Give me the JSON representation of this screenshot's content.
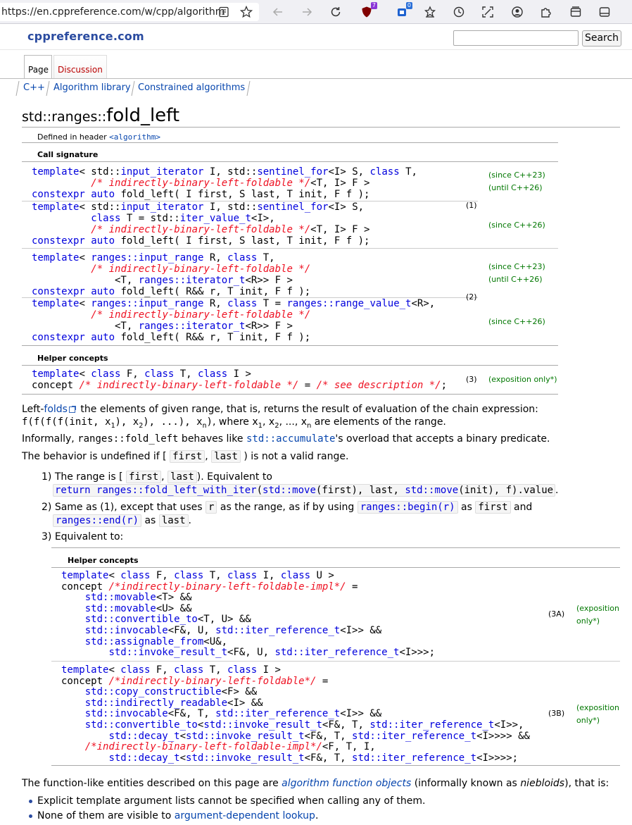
{
  "browser": {
    "url": "https://en.cppreference.com/w/cpp/algorithm",
    "badge_shield": "7",
    "badge_ext": "0"
  },
  "site": {
    "logo": "cppreference.com",
    "search_button": "Search",
    "tabs": [
      "Page",
      "Discussion"
    ],
    "breadcrumbs": [
      "C++",
      "Algorithm library",
      "Constrained algorithms"
    ]
  },
  "title": {
    "ns": "std::ranges::",
    "name": "fold_left"
  },
  "header_decl": {
    "prefix": "Defined in header ",
    "header": "<algorithm>"
  },
  "sections": {
    "call_signature": "Call signature",
    "helper_concepts": "Helper concepts"
  },
  "versions": {
    "since23": "(since C++23)",
    "until26": "(until C++26)",
    "since26": "(since C++26)",
    "expo": "(exposition only*)",
    "expo1": "(exposition",
    "expo2": "only*)"
  },
  "tags": {
    "t1": "(1)",
    "t2": "(2)",
    "t3": "(3)",
    "t3a": "(3A)",
    "t3b": "(3B)"
  },
  "desc": {
    "p1_a": "Left-",
    "p1_link": "folds",
    "p1_b": " the elements of given range, that is, returns the result of evaluation of the chain expression:",
    "p1_line2": ", where x",
    "p1_line2b": " are elements of the range.",
    "p2_a": "Informally, ",
    "p2_code": "ranges::fold_left",
    "p2_b": " behaves like ",
    "p2_link": "std::accumulate",
    "p2_c": "'s overload that accepts a binary predicate.",
    "p3_a": "The behavior is undefined if [",
    "p3_b": ",",
    "p3_c": ") is not a valid range.",
    "first": "first",
    "last": "last",
    "r": "r",
    "item1_a": "1) The range is [",
    "item1_b": ",",
    "item1_c": "). Equivalent to",
    "item2_a": "2) Same as (1), except that uses",
    "item2_b": "as the range, as if by using",
    "item2_c": "as",
    "item2_d": "and",
    "item2_e": "as",
    "item2_begin": "ranges::begin(r)",
    "item2_end": "ranges::end(r)",
    "item3": "3) Equivalent to:",
    "footer_a": "The function-like entities described on this page are ",
    "footer_link": "algorithm function objects",
    "footer_b": " (informally known as ",
    "footer_em": "niebloids",
    "footer_c": "), that is:",
    "bullet1": "Explicit template argument lists cannot be specified when calling any of them.",
    "bullet2_a": "None of them are visible to ",
    "bullet2_link": "argument-dependent lookup",
    "bullet2_b": "."
  }
}
